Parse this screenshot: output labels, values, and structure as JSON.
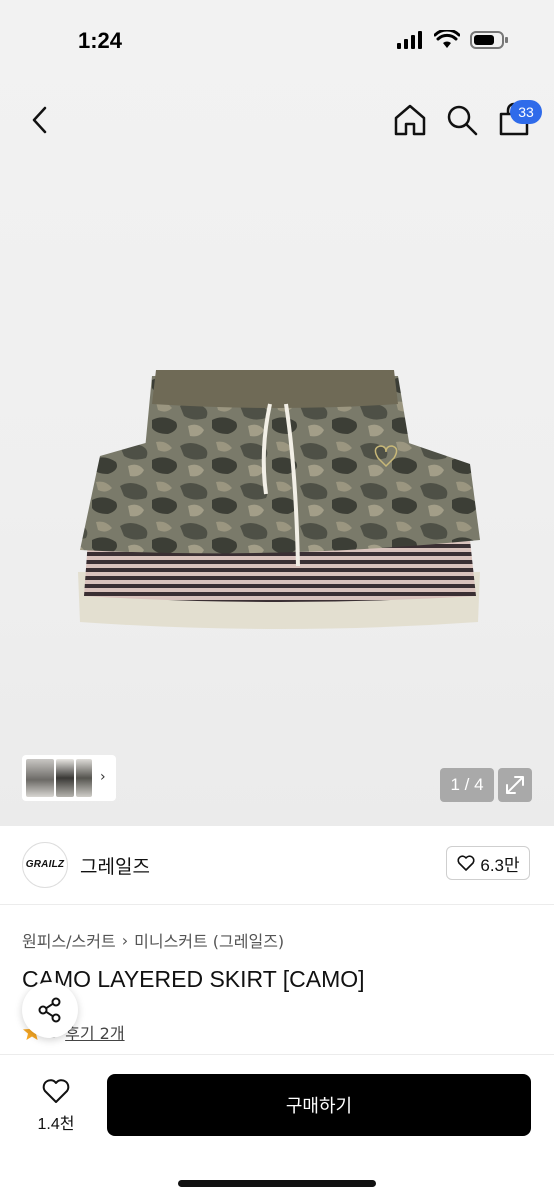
{
  "status_bar": {
    "time": "1:24"
  },
  "header": {
    "cart_count": "33"
  },
  "gallery": {
    "page_counter": "1 / 4",
    "thumb_chevron": "›"
  },
  "brand": {
    "logo_text": "GRAILZ",
    "name": "그레일즈",
    "likes": "6.3만"
  },
  "breadcrumb": {
    "category": "원피스/스커트",
    "separator": "›",
    "subcategory": "미니스커트 (그레일즈)"
  },
  "product": {
    "title": "CAMO LAYERED SKIRT [CAMO]",
    "rating": "5",
    "reviews_label": "후기 2개"
  },
  "bottom_bar": {
    "wish_count": "1.4천",
    "buy_label": "구매하기"
  },
  "colors": {
    "accent_badge": "#2f6bea",
    "buy_button": "#000000",
    "star": "#f5a623"
  }
}
